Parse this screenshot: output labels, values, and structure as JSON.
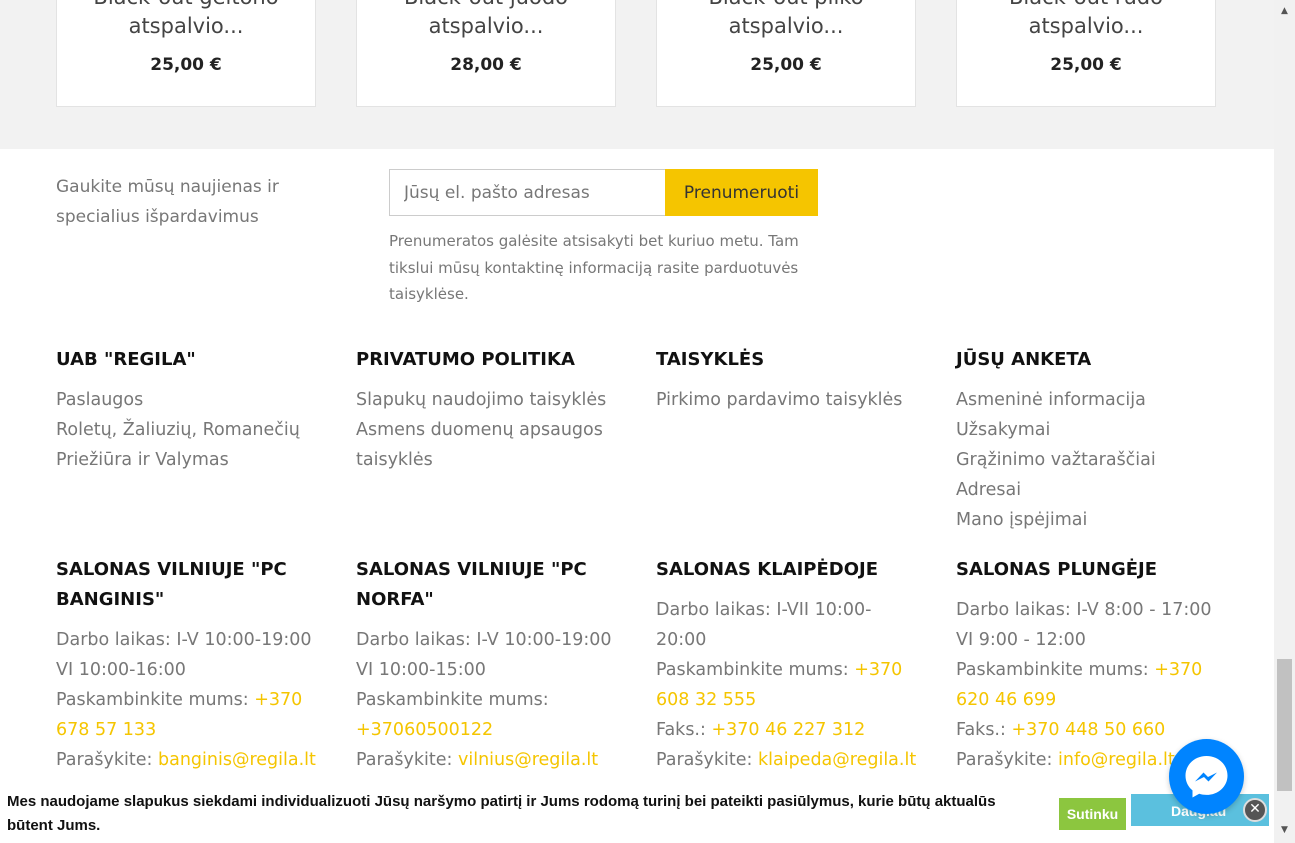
{
  "products": [
    {
      "title_line1": "Black-out geltono",
      "title_line2": "atspalvio...",
      "price": "25,00 €"
    },
    {
      "title_line1": "Black-out juodo",
      "title_line2": "atspalvio...",
      "price": "28,00 €"
    },
    {
      "title_line1": "Black-out pilko",
      "title_line2": "atspalvio...",
      "price": "25,00 €"
    },
    {
      "title_line1": "Black-out rudo",
      "title_line2": "atspalvio...",
      "price": "25,00 €"
    }
  ],
  "newsletter": {
    "text": "Gaukite mūsų naujienas ir specialius išpardavimus",
    "placeholder": "Jūsų el. pašto adresas",
    "button": "Prenumeruoti",
    "note": "Prenumeratos galėsite atsisakyti bet kuriuo metu. Tam tikslui mūsų kontaktinę informaciją rasite parduotuvės taisyklėse."
  },
  "footer_columns": [
    {
      "heading": "UAB \"REGILA\"",
      "links": [
        "Paslaugos",
        "Roletų, Žaliuzių, Romanečių Priežiūra ir Valymas"
      ]
    },
    {
      "heading": "PRIVATUMO POLITIKA",
      "links": [
        "Slapukų naudojimo taisyklės",
        "Asmens duomenų apsaugos taisyklės"
      ]
    },
    {
      "heading": "TAISYKLĖS",
      "links": [
        "Pirkimo pardavimo taisyklės"
      ]
    },
    {
      "heading": "JŪSŲ ANKETA",
      "links": [
        "Asmeninė informacija",
        "Užsakymai",
        "Grąžinimo važtaraščiai",
        "Adresai",
        "Mano įspėjimai"
      ]
    }
  ],
  "salons": [
    {
      "heading": "SALONAS VILNIUJE \"PC BANGINIS\"",
      "hours": "Darbo laikas: I-V 10:00-19:00 VI 10:00-16:00",
      "call_label": "Paskambinkite mums:",
      "phone": "+370 678 57 133",
      "email_label": "Parašykite:",
      "email": "banginis@regila.lt"
    },
    {
      "heading": "SALONAS VILNIUJE \"PC NORFA\"",
      "hours": "Darbo laikas: I-V 10:00-19:00 VI 10:00-15:00",
      "call_label": "Paskambinkite mums:",
      "phone": "+37060500122",
      "email_label": "Parašykite:",
      "email": "vilnius@regila.lt"
    },
    {
      "heading": "SALONAS KLAIPĖDOJE",
      "hours": "Darbo laikas: I-VII 10:00-20:00",
      "call_label": "Paskambinkite mums:",
      "phone": "+370 608 32 555",
      "fax_label": "Faks.:",
      "fax": "+370 46 227 312",
      "email_label": "Parašykite:",
      "email": "klaipeda@regila.lt"
    },
    {
      "heading": "SALONAS PLUNGĖJE",
      "hours": "Darbo laikas: I-V 8:00 - 17:00 VI 9:00 - 12:00",
      "call_label": "Paskambinkite mums:",
      "phone": "+370 620 46 699",
      "fax_label": "Faks.:",
      "fax": "+370 448 50 660",
      "email_label": "Parašykite:",
      "email": "info@regila.lt"
    }
  ],
  "cookie": {
    "text": "Mes naudojame slapukus siekdami individualizuoti Jūsų naršymo patirtį ir Jums rodomą turinį bei pateikti pasiūlymus, kurie būtų aktualūs būtent Jums.",
    "agree": "Sutinku",
    "more": "Daugiau",
    "close": "✕"
  },
  "colors": {
    "accent": "#f5c500",
    "messenger": "#0084ff",
    "agree": "#8cc63f",
    "more": "#5bc0de"
  }
}
